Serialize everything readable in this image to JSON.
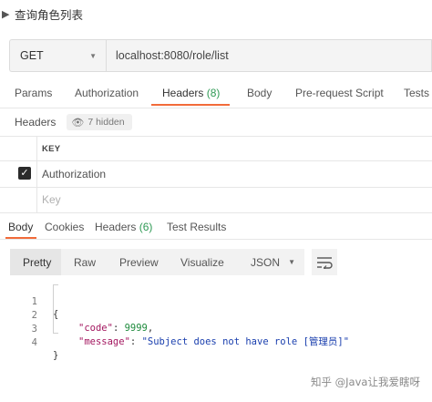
{
  "page": {
    "title": "查询角色列表"
  },
  "request": {
    "method": "GET",
    "url": "localhost:8080/role/list"
  },
  "request_tabs": [
    {
      "label": "Params"
    },
    {
      "label": "Authorization"
    },
    {
      "label": "Headers",
      "count": "(8)"
    },
    {
      "label": "Body"
    },
    {
      "label": "Pre-request Script"
    },
    {
      "label": "Tests"
    }
  ],
  "headers_panel": {
    "label": "Headers",
    "hidden_badge": "7 hidden",
    "column_key": "KEY",
    "rows": [
      {
        "key": "Authorization",
        "checked": true
      }
    ],
    "key_placeholder": "Key"
  },
  "response_tabs": [
    {
      "label": "Body"
    },
    {
      "label": "Cookies"
    },
    {
      "label": "Headers",
      "count": "(6)"
    },
    {
      "label": "Test Results"
    }
  ],
  "view_modes": [
    "Pretty",
    "Raw",
    "Preview",
    "Visualize"
  ],
  "format": "JSON",
  "code_lines": [
    {
      "n": "1",
      "text": "{"
    },
    {
      "n": "2",
      "key": "\"code\"",
      "value": "9999",
      "suffix": ","
    },
    {
      "n": "3",
      "key": "\"message\"",
      "value": "\"Subject does not have role [管理员]\""
    },
    {
      "n": "4",
      "text": "}"
    }
  ],
  "watermark": "知乎 @Java让我爱瞎呀",
  "colors": {
    "accent": "#f26b3a",
    "count": "#2f9a55",
    "json_key": "#a3165f",
    "json_string": "#1a3fae",
    "json_number": "#1f8b3d"
  }
}
